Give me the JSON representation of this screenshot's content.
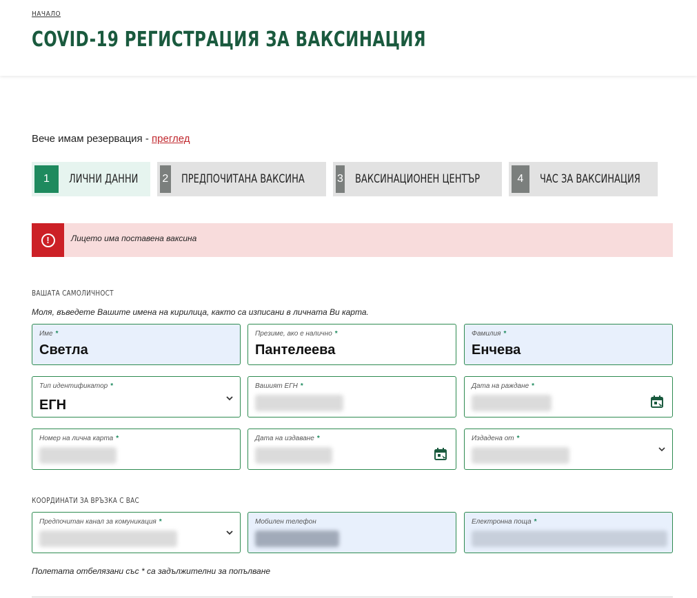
{
  "header": {
    "breadcrumb": "НАЧАЛО",
    "title": "COVID-19 РЕГИСТРАЦИЯ ЗА ВАКСИНАЦИЯ"
  },
  "reservation": {
    "text": "Вече имам резервация - ",
    "link": "преглед"
  },
  "steps": [
    {
      "num": "1",
      "label": "ЛИЧНИ ДАННИ"
    },
    {
      "num": "2",
      "label": "ПРЕДПОЧИТАНА ВАКСИНА"
    },
    {
      "num": "3",
      "label": "ВАКСИНАЦИОНЕН ЦЕНТЪР"
    },
    {
      "num": "4",
      "label": "ЧАС ЗА ВАКСИНАЦИЯ"
    }
  ],
  "alert": {
    "icon": "!",
    "text": "Лицето има поставена ваксина"
  },
  "identity": {
    "section_title": "ВАШАТА САМОЛИЧНОСТ",
    "hint": "Моля, въведете Вашите имена на кирилица, както са изписани в личната Ви карта.",
    "first_name": {
      "label": "Име",
      "value": "Светла"
    },
    "middle_name": {
      "label": "Презиме, ако е налично",
      "value": "Пантелеева"
    },
    "last_name": {
      "label": "Фамилия",
      "value": "Енчева"
    },
    "id_type": {
      "label": "Тип идентификатор",
      "value": "ЕГН"
    },
    "egn": {
      "label": "Вашият ЕГН"
    },
    "birth_date": {
      "label": "Дата на раждане"
    },
    "id_card": {
      "label": "Номер на лична карта"
    },
    "issue_date": {
      "label": "Дата на издаване"
    },
    "issued_by": {
      "label": "Издадена от"
    }
  },
  "contacts": {
    "section_title": "КООРДИНАТИ ЗА ВРЪЗКА С ВАС",
    "channel": {
      "label": "Предпочитан канал за комуникация"
    },
    "phone": {
      "label": "Мобилен телефон"
    },
    "email": {
      "label": "Електронна поща"
    }
  },
  "required_mark": "*",
  "footer_note": "Полетата отбелязани със * са задължителни за попълване",
  "colors": {
    "title": "#1a5a3e",
    "active_step": "#1e8a5e",
    "inactive_step": "#7b7f7d",
    "alert_bg": "#f8dcdc",
    "alert_icon_bg": "#cc2026",
    "field_border": "#2c8a4f",
    "filled_bg": "#e8f0fc"
  }
}
